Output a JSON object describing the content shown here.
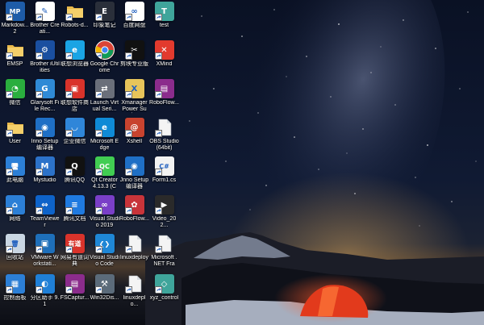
{
  "desktop": {
    "icons": [
      {
        "label": "Markdow... 2",
        "icon": "markdown-mp-icon",
        "color": "#1e5ca8",
        "glyph": "MP"
      },
      {
        "label": "Brother Creati...",
        "icon": "brother-creative-icon",
        "color": "#ffffff",
        "glyph": "✎"
      },
      {
        "label": "Robots-d...",
        "icon": "folder-icon",
        "color": "#e8b84a",
        "glyph": ""
      },
      {
        "label": "印象笔记",
        "icon": "evernote-icon",
        "color": "#2a2f3a",
        "glyph": "E"
      },
      {
        "label": "百度网盘",
        "icon": "baidu-netdisk-icon",
        "color": "#ffffff",
        "glyph": "∞"
      },
      {
        "label": "test",
        "icon": "test-app-icon",
        "color": "#3fa59b",
        "glyph": "T"
      },
      {
        "label": "EMSP",
        "icon": "folder-icon",
        "color": "#e8b84a",
        "glyph": ""
      },
      {
        "label": "Brother iUtilities",
        "icon": "brother-utilities-icon",
        "color": "#1a4fa0",
        "glyph": "⚙"
      },
      {
        "label": "联想浏览器",
        "icon": "lenovo-browser-icon",
        "color": "#1aa4e4",
        "glyph": "e"
      },
      {
        "label": "Google Chrome",
        "icon": "chrome-icon",
        "color": "#ffffff",
        "glyph": ""
      },
      {
        "label": "剪映专业版",
        "icon": "jianying-icon",
        "color": "#111111",
        "glyph": "✂"
      },
      {
        "label": "XMind",
        "icon": "xmind-icon",
        "color": "#e23a2e",
        "glyph": "✕"
      },
      {
        "label": "微信",
        "icon": "wechat-icon",
        "color": "#2aae3e",
        "glyph": "◔"
      },
      {
        "label": "Glarysoft File Rec...",
        "icon": "glarysoft-icon",
        "color": "#2f8ad6",
        "glyph": "G"
      },
      {
        "label": "联想软件商店",
        "icon": "lenovo-store-icon",
        "color": "#d9332b",
        "glyph": "▣"
      },
      {
        "label": "Launch Virtual Seri...",
        "icon": "virtual-serial-icon",
        "color": "#6a6f7a",
        "glyph": "⇄"
      },
      {
        "label": "Xmanager Power Sui...",
        "icon": "xmanager-icon",
        "color": "#e7c45a",
        "glyph": "X"
      },
      {
        "label": "RoboFlow...",
        "icon": "winrar-icon",
        "color": "#8b2c8c",
        "glyph": "▤"
      },
      {
        "label": "User",
        "icon": "user-folder-icon",
        "color": "#e8b84a",
        "glyph": "👤"
      },
      {
        "label": "Inno Setup 编译器",
        "icon": "inno-setup-icon",
        "color": "#1f6fc5",
        "glyph": "◉"
      },
      {
        "label": "企业微信",
        "icon": "wecom-icon",
        "color": "#2f86d9",
        "glyph": "◡"
      },
      {
        "label": "Microsoft Edge",
        "icon": "edge-icon",
        "color": "#0f8ad6",
        "glyph": "e"
      },
      {
        "label": "Xshell",
        "icon": "xshell-icon",
        "color": "#c8432f",
        "glyph": "@"
      },
      {
        "label": "OBS Studio (64bit)",
        "icon": "file-icon",
        "color": "#f2f2f2",
        "glyph": ""
      },
      {
        "label": "此电脑",
        "icon": "this-pc-icon",
        "color": "#2c7fd6",
        "glyph": "🖥"
      },
      {
        "label": "Mystudio",
        "icon": "mystudio-icon",
        "color": "#2c72c9",
        "glyph": "M"
      },
      {
        "label": "腾讯QQ",
        "icon": "qq-icon",
        "color": "#111111",
        "glyph": "Q"
      },
      {
        "label": "Qt Creator 4.13.3 (Co...",
        "icon": "qt-creator-icon",
        "color": "#41cd52",
        "glyph": "QC"
      },
      {
        "label": "Jnno Setup 编译器",
        "icon": "inno-setup-icon",
        "color": "#1f6fc5",
        "glyph": "◉"
      },
      {
        "label": "Form1.cs",
        "icon": "csharp-file-icon",
        "color": "#f2f2f2",
        "glyph": "C#"
      },
      {
        "label": "网络",
        "icon": "network-icon",
        "color": "#2c7fd6",
        "glyph": "⌂"
      },
      {
        "label": "TeamViewer",
        "icon": "teamviewer-icon",
        "color": "#0e63c9",
        "glyph": "⇔"
      },
      {
        "label": "腾讯文档",
        "icon": "tencent-docs-icon",
        "color": "#1f7ae0",
        "glyph": "≡"
      },
      {
        "label": "Visual Studio 2019",
        "icon": "visual-studio-icon",
        "color": "#7a3fc8",
        "glyph": "∞"
      },
      {
        "label": "RoboFlow...",
        "icon": "roboflow-icon",
        "color": "#c8343a",
        "glyph": "✿"
      },
      {
        "label": "Video_202...",
        "icon": "video-file-icon",
        "color": "#2a2a2a",
        "glyph": "▶"
      },
      {
        "label": "回收站",
        "icon": "recycle-bin-icon",
        "color": "#c9d6e3",
        "glyph": "🗑"
      },
      {
        "label": "VMware Workstati...",
        "icon": "vmware-icon",
        "color": "#1e6fba",
        "glyph": "▣"
      },
      {
        "label": "网易有道词典",
        "icon": "youdao-icon",
        "color": "#d9332b",
        "glyph": "有道"
      },
      {
        "label": "Visual Studio Code",
        "icon": "vscode-icon",
        "color": "#1f87d6",
        "glyph": "❮❯"
      },
      {
        "label": "linuxdeploy",
        "icon": "file-icon",
        "color": "#f2f2f2",
        "glyph": ""
      },
      {
        "label": "Microsoft .NET Fram...",
        "icon": "file-icon",
        "color": "#f2f2f2",
        "glyph": ""
      },
      {
        "label": "控制面板",
        "icon": "control-panel-icon",
        "color": "#2c7fd6",
        "glyph": "▦"
      },
      {
        "label": "分区助手 9.1",
        "icon": "partition-assistant-icon",
        "color": "#1f7fd6",
        "glyph": "◐"
      },
      {
        "label": "FSCaptur...",
        "icon": "winrar-icon",
        "color": "#8b2c8c",
        "glyph": "▤"
      },
      {
        "label": "Win32Dis...",
        "icon": "win32disk-icon",
        "color": "#5b6b7a",
        "glyph": "⚒"
      },
      {
        "label": "linuxdeplo...",
        "icon": "file-icon",
        "color": "#f2f2f2",
        "glyph": ""
      },
      {
        "label": "xyz_control",
        "icon": "xyz-control-icon",
        "color": "#3fa59b",
        "glyph": "◇"
      }
    ]
  }
}
